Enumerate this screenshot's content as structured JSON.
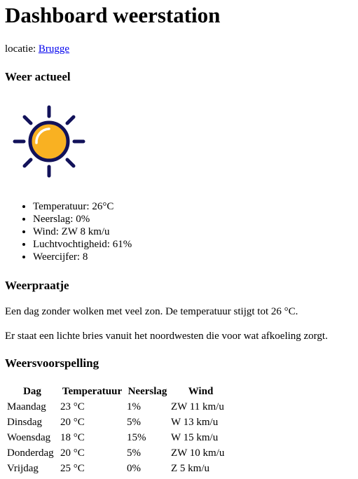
{
  "page": {
    "title": "Dashboard weerstation",
    "location_label": "locatie: ",
    "location_link": "Brugge"
  },
  "current": {
    "heading": "Weer actueel",
    "icon": "sun-icon",
    "stats": [
      "Temperatuur: 26°C",
      "Neerslag: 0%",
      "Wind: ZW 8 km/u",
      "Luchtvochtigheid: 61%",
      "Weercijfer: 8"
    ]
  },
  "talk": {
    "heading": "Weerpraatje",
    "paragraphs": [
      "Een dag zonder wolken met veel zon. De temperatuur stijgt tot 26 °C.",
      "Er staat een lichte bries vanuit het noordwesten die voor wat afkoeling zorgt."
    ]
  },
  "forecast": {
    "heading": "Weersvoorspelling",
    "columns": [
      "Dag",
      "Temperatuur",
      "Neerslag",
      "Wind"
    ],
    "rows": [
      [
        "Maandag",
        "23 °C",
        "1%",
        "ZW 11 km/u"
      ],
      [
        "Dinsdag",
        "20 °C",
        "5%",
        "W 13 km/u"
      ],
      [
        "Woensdag",
        "18 °C",
        "15%",
        "W 15 km/u"
      ],
      [
        "Donderdag",
        "20 °C",
        "5%",
        "ZW 10 km/u"
      ],
      [
        "Vrijdag",
        "25 °C",
        "0%",
        "Z 5 km/u"
      ]
    ]
  },
  "colors": {
    "sun_fill": "#f9b122",
    "sun_outline": "#12125a",
    "link": "#0000ee"
  }
}
